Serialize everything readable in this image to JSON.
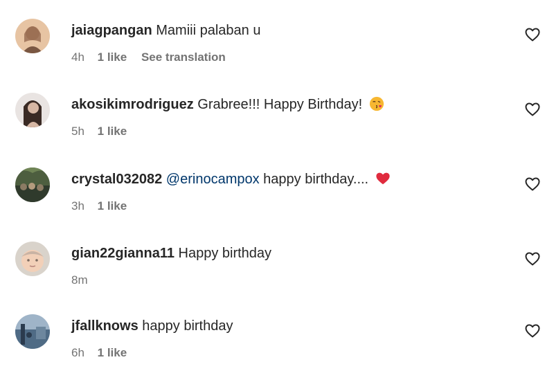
{
  "comments": [
    {
      "username": "jaiagpangan",
      "mention": "",
      "text": "Mamiii palaban u",
      "time": "4h",
      "likes": "1 like",
      "translation": "See translation",
      "emoji": "",
      "avatar_colors": [
        "#c79a7a",
        "#e7c4a3",
        "#7a5742"
      ]
    },
    {
      "username": "akosikimrodriguez",
      "mention": "",
      "text": "Grabree!!! Happy Birthday!",
      "time": "5h",
      "likes": "1 like",
      "translation": "",
      "emoji": "face-blowing-kiss",
      "avatar_colors": [
        "#e9e4e2",
        "#3a2a24",
        "#d7b7a4"
      ]
    },
    {
      "username": "crystal032082",
      "mention": "@erinocampox",
      "text": "happy birthday....",
      "time": "3h",
      "likes": "1 like",
      "translation": "",
      "emoji": "red-heart",
      "avatar_colors": [
        "#4d5e3f",
        "#8b7b63",
        "#2f3a2c"
      ]
    },
    {
      "username": "gian22gianna11",
      "mention": "",
      "text": "Happy birthday",
      "time": "8m",
      "likes": "",
      "translation": "",
      "emoji": "",
      "avatar_colors": [
        "#d9d3cb",
        "#f2d0b8",
        "#7d6b60"
      ]
    },
    {
      "username": "jfallknows",
      "mention": "",
      "text": "happy birthday",
      "time": "6h",
      "likes": "1 like",
      "translation": "",
      "emoji": "",
      "avatar_colors": [
        "#4f6b85",
        "#9fb4c8",
        "#2b3b4e"
      ]
    }
  ],
  "icons": {
    "like": "heart-outline-icon"
  },
  "colors": {
    "text": "#262626",
    "secondary": "#737373",
    "mention": "#00376b",
    "emoji_heart": "#e0245e"
  }
}
